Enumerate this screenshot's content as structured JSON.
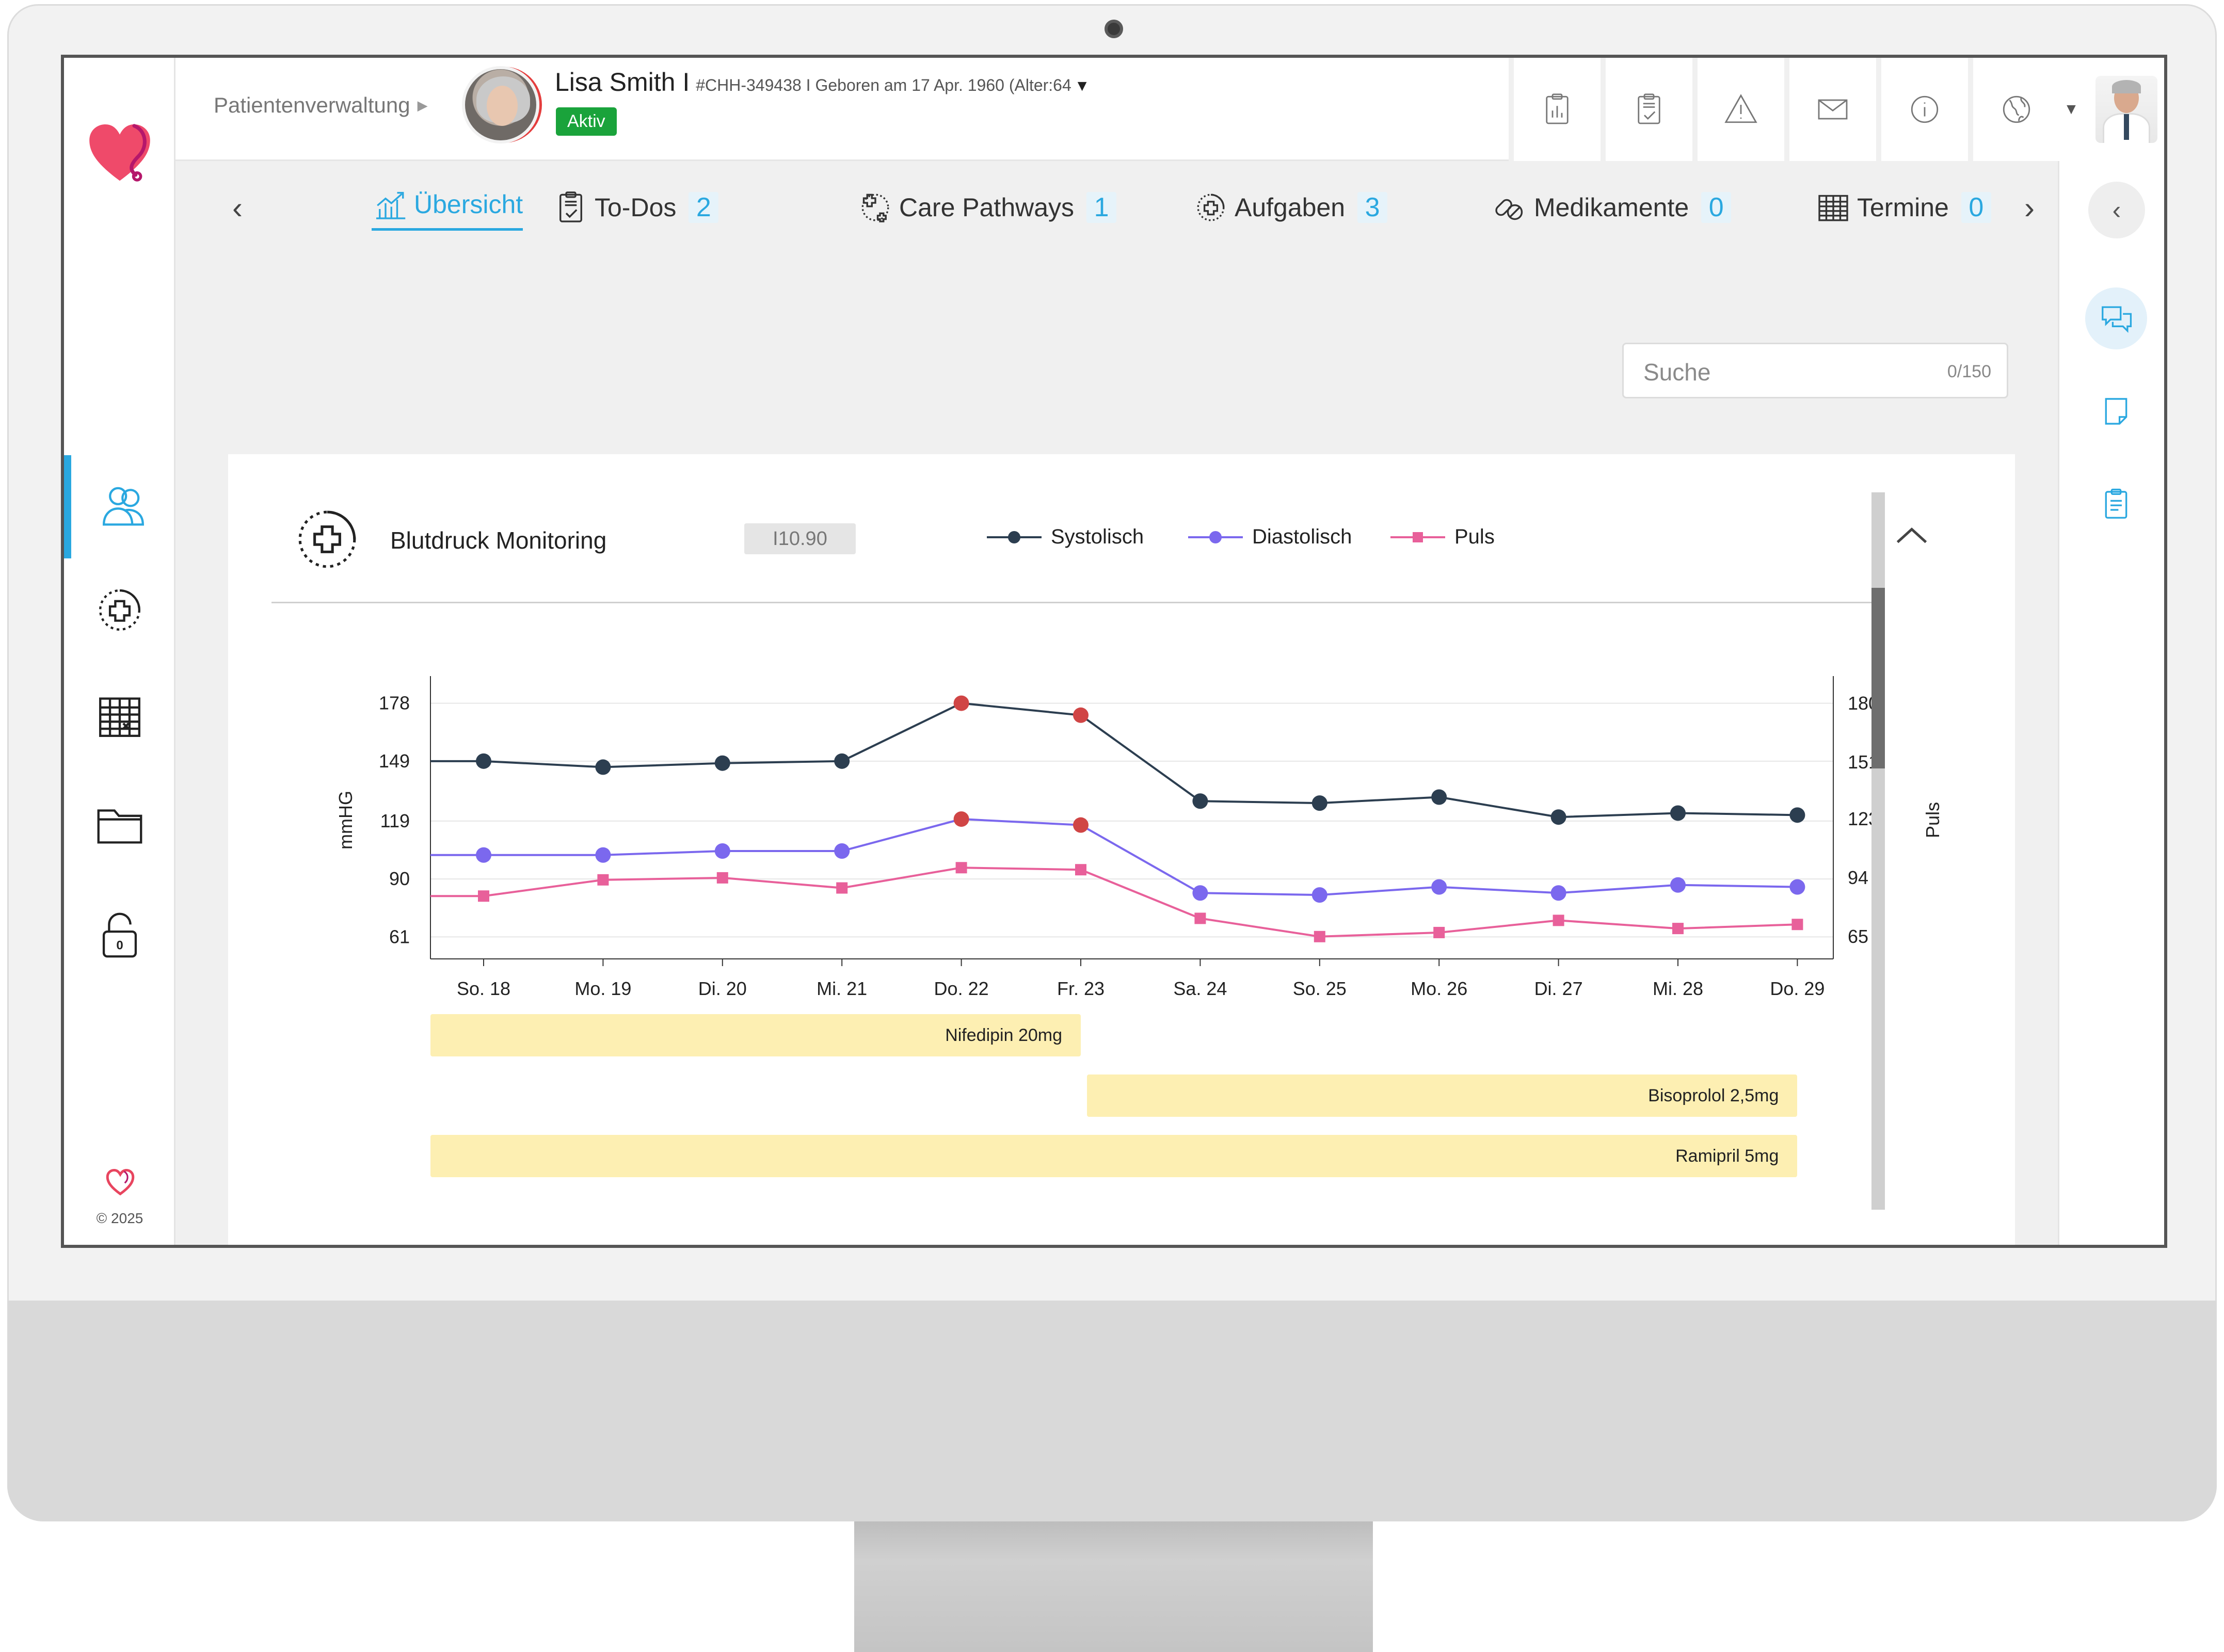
{
  "header": {
    "breadcrumb": "Patientenverwaltung",
    "patient_name": "Lisa Smith I",
    "patient_meta": "#CHH-349438 I Geboren am 17 Apr. 1960 (Alter:64",
    "status": "Aktiv",
    "icons": [
      "report-icon",
      "checklist-icon",
      "warning-icon",
      "mail-icon",
      "info-icon",
      "globe-icon"
    ]
  },
  "tabs": [
    {
      "label": "Übersicht",
      "count": "",
      "icon": "chart-icon",
      "active": true
    },
    {
      "label": "To-Dos",
      "count": "2",
      "icon": "clipboard-check-icon"
    },
    {
      "label": "Care Pathways",
      "count": "1",
      "icon": "care-pathway-icon"
    },
    {
      "label": "Aufgaben",
      "count": "3",
      "icon": "task-plus-icon"
    },
    {
      "label": "Medikamente",
      "count": "0",
      "icon": "pills-icon"
    },
    {
      "label": "Termine",
      "count": "0",
      "icon": "calendar-icon"
    }
  ],
  "search": {
    "placeholder": "Suche",
    "counter": "0/150"
  },
  "card": {
    "title": "Blutdruck Monitoring",
    "value": "I10.90",
    "legend": {
      "systolic": "Systolisch",
      "diastolic": "Diastolisch",
      "pulse": "Puls"
    }
  },
  "footer": {
    "copyright": "© 2025"
  },
  "colors": {
    "accent": "#2aa8e0",
    "systolic": "#2c3e50",
    "diastolic": "#7b68ee",
    "pulse": "#e8609a",
    "alert": "#d04545",
    "medication": "#fdefb2",
    "active_badge": "#1aa33b"
  },
  "chart_data": {
    "type": "line",
    "categories": [
      "So. 18",
      "Mo. 19",
      "Di. 20",
      "Mi. 21",
      "Do. 22",
      "Fr. 23",
      "Sa. 24",
      "So. 25",
      "Mo. 26",
      "Di. 27",
      "Mi. 28",
      "Do. 29"
    ],
    "ylabel": "mmHG",
    "y2label": "Puls",
    "yticks": [
      178,
      149,
      119,
      90,
      61
    ],
    "y2ticks": [
      180,
      151,
      123,
      94,
      65
    ],
    "ylim": [
      50,
      189
    ],
    "y2lim": [
      54,
      191
    ],
    "grid": true,
    "series": [
      {
        "name": "Systolisch",
        "axis": "left",
        "values": [
          149,
          146,
          148,
          149,
          178,
          172,
          129,
          128,
          131,
          121,
          123,
          122
        ],
        "alerts": [
          4,
          5
        ]
      },
      {
        "name": "Diastolisch",
        "axis": "left",
        "values": [
          102,
          102,
          104,
          104,
          120,
          117,
          83,
          82,
          86,
          83,
          87,
          86
        ],
        "alerts": [
          4,
          5
        ]
      },
      {
        "name": "Puls",
        "axis": "right",
        "values": [
          85,
          93,
          94,
          89,
          99,
          98,
          74,
          65,
          67,
          73,
          69,
          71
        ]
      }
    ],
    "medications": [
      {
        "label": "Nifedipin 20mg",
        "start": 0,
        "end": 5
      },
      {
        "label": "Bisoprolol 2,5mg",
        "start": 5,
        "end": 11
      },
      {
        "label": "Ramipril 5mg",
        "start": 0,
        "end": 11
      }
    ]
  }
}
